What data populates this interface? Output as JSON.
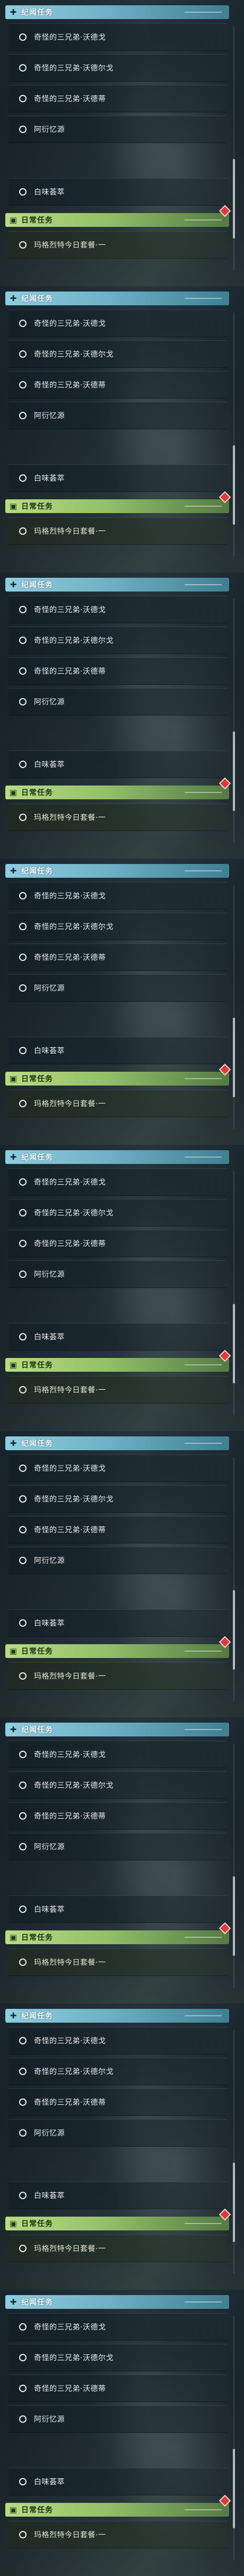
{
  "panel_count": 9,
  "sections": {
    "story": {
      "title": "纪闻任务",
      "icon": "plus-icon",
      "items": [
        {
          "label": "奇怪的三兄弟·沃德戈"
        },
        {
          "label": "奇怪的三兄弟·沃德尔戈"
        },
        {
          "label": "奇怪的三兄弟·沃德蒂"
        },
        {
          "label": "阿衍忆源"
        },
        {
          "label": "白味荟萃"
        }
      ]
    },
    "daily": {
      "title": "日常任务",
      "icon": "calendar-icon",
      "items": [
        {
          "label": "玛格烈特今日套餐·一"
        }
      ]
    }
  },
  "colors": {
    "story_header": "#8fcde0",
    "daily_header": "#b8dc84",
    "badge": "#d83c3c"
  }
}
